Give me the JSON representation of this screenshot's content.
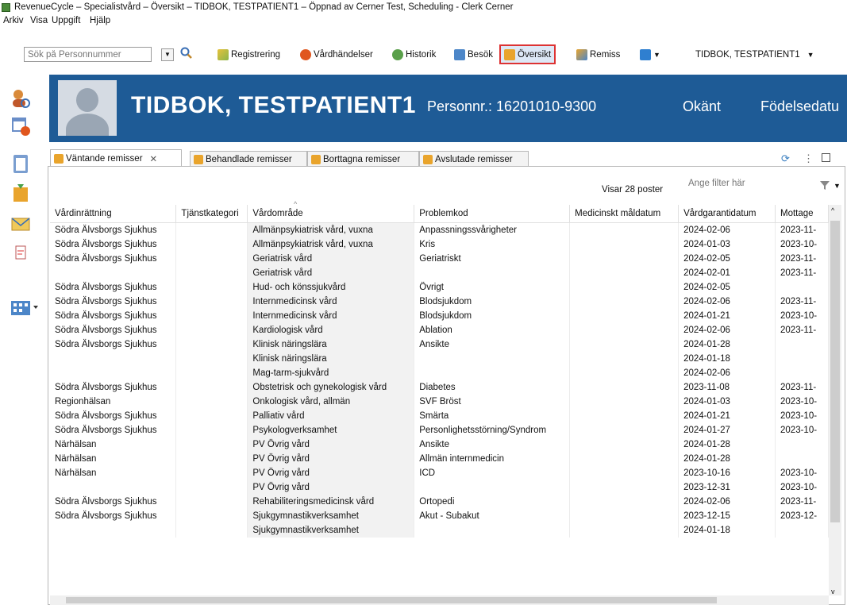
{
  "window": {
    "title": "RevenueCycle – Specialistvård – Översikt – TIDBOK, TESTPATIENT1 – Öppnad av Cerner Test, Scheduling - Clerk Cerner"
  },
  "menu": [
    "Arkiv",
    "Visa",
    "Uppgift",
    "Hjälp"
  ],
  "toolbar": {
    "search_placeholder": "Sök på Personnummer",
    "buttons": {
      "registrering": "Registrering",
      "vardhandelser": "Vårdhändelser",
      "historik": "Historik",
      "besok": "Besök",
      "oversikt": "Översikt",
      "remiss": "Remiss"
    },
    "patient_selector": "TIDBOK, TESTPATIENT1"
  },
  "banner": {
    "name": "TIDBOK, TESTPATIENT1",
    "personnr": "Personnr.: 16201010-9300",
    "gender": "Okänt",
    "birthdate_label": "Födelsedatu"
  },
  "tabs": {
    "vantande": "Väntande remisser",
    "behandlade": "Behandlade remisser",
    "borttagna": "Borttagna remisser",
    "avslutade": "Avslutade remisser"
  },
  "list": {
    "count_text": "Visar 28 poster",
    "filter_placeholder": "Ange filter här",
    "columns": [
      "Vårdinrättning",
      "Tjänstkategori",
      "Vårdområde",
      "Problemkod",
      "Medicinskt måldatum",
      "Vårdgarantidatum",
      "Mottage"
    ],
    "rows": [
      [
        "Södra Älvsborgs Sjukhus",
        "",
        "Allmänpsykiatrisk vård, vuxna",
        "Anpassningssvårigheter",
        "",
        "2024-02-06",
        "2023-11-"
      ],
      [
        "Södra Älvsborgs Sjukhus",
        "",
        "Allmänpsykiatrisk vård, vuxna",
        "Kris",
        "",
        "2024-01-03",
        "2023-10-"
      ],
      [
        "Södra Älvsborgs Sjukhus",
        "",
        "Geriatrisk vård",
        "Geriatriskt",
        "",
        "2024-02-05",
        "2023-11-"
      ],
      [
        "",
        "",
        "Geriatrisk vård",
        "",
        "",
        "2024-02-01",
        "2023-11-"
      ],
      [
        "Södra Älvsborgs Sjukhus",
        "",
        "Hud- och könssjukvård",
        "Övrigt",
        "",
        "2024-02-05",
        ""
      ],
      [
        "Södra Älvsborgs Sjukhus",
        "",
        "Internmedicinsk vård",
        "Blodsjukdom",
        "",
        "2024-02-06",
        "2023-11-"
      ],
      [
        "Södra Älvsborgs Sjukhus",
        "",
        "Internmedicinsk vård",
        "Blodsjukdom",
        "",
        "2024-01-21",
        "2023-10-"
      ],
      [
        "Södra Älvsborgs Sjukhus",
        "",
        "Kardiologisk vård",
        "Ablation",
        "",
        "2024-02-06",
        "2023-11-"
      ],
      [
        "Södra Älvsborgs Sjukhus",
        "",
        "Klinisk näringslära",
        "Ansikte",
        "",
        "2024-01-28",
        ""
      ],
      [
        "",
        "",
        "Klinisk näringslära",
        "",
        "",
        "2024-01-18",
        ""
      ],
      [
        "",
        "",
        "Mag-tarm-sjukvård",
        "",
        "",
        "2024-02-06",
        ""
      ],
      [
        "Södra Älvsborgs Sjukhus",
        "",
        "Obstetrisk och gynekologisk vård",
        "Diabetes",
        "",
        "2023-11-08",
        "2023-11-"
      ],
      [
        "Regionhälsan",
        "",
        "Onkologisk vård, allmän",
        "SVF Bröst",
        "",
        "2024-01-03",
        "2023-10-"
      ],
      [
        "Södra Älvsborgs Sjukhus",
        "",
        "Palliativ vård",
        "Smärta",
        "",
        "2024-01-21",
        "2023-10-"
      ],
      [
        "Södra Älvsborgs Sjukhus",
        "",
        "Psykologverksamhet",
        "Personlighetsstörning/Syndrom",
        "",
        "2024-01-27",
        "2023-10-"
      ],
      [
        "Närhälsan",
        "",
        "PV Övrig vård",
        "Ansikte",
        "",
        "2024-01-28",
        ""
      ],
      [
        "Närhälsan",
        "",
        "PV Övrig vård",
        "Allmän internmedicin",
        "",
        "2024-01-28",
        ""
      ],
      [
        "Närhälsan",
        "",
        "PV Övrig vård",
        "ICD",
        "",
        "2023-10-16",
        "2023-10-"
      ],
      [
        "",
        "",
        "PV Övrig vård",
        "",
        "",
        "2023-12-31",
        "2023-10-"
      ],
      [
        "Södra Älvsborgs Sjukhus",
        "",
        "Rehabiliteringsmedicinsk vård",
        "Ortopedi",
        "",
        "2024-02-06",
        "2023-11-"
      ],
      [
        "Södra Älvsborgs Sjukhus",
        "",
        "Sjukgymnastikverksamhet",
        "Akut - Subakut",
        "",
        "2023-12-15",
        "2023-12-"
      ],
      [
        "",
        "",
        "Sjukgymnastikverksamhet",
        "",
        "",
        "2024-01-18",
        ""
      ]
    ]
  }
}
